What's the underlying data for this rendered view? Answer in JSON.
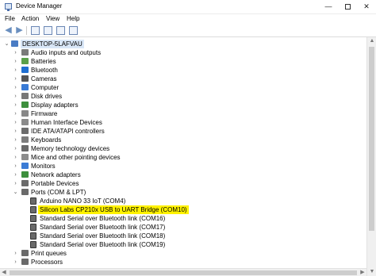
{
  "window": {
    "title": "Device Manager",
    "controls": {
      "minimize": "—",
      "close": "✕"
    }
  },
  "menu": [
    "File",
    "Action",
    "View",
    "Help"
  ],
  "toolbar": {
    "back": "◀",
    "forward": "▶"
  },
  "tree": {
    "root": "DESKTOP-5LAFVAU",
    "collapsed_glyph": "›",
    "expanded_glyph": "⌄",
    "categories": [
      {
        "label": "Audio inputs and outputs",
        "icon": "speaker-icon",
        "color": "#7a7a7a"
      },
      {
        "label": "Batteries",
        "icon": "battery-icon",
        "color": "#5aa04a"
      },
      {
        "label": "Bluetooth",
        "icon": "bluetooth-icon",
        "color": "#1f6fd1"
      },
      {
        "label": "Cameras",
        "icon": "camera-icon",
        "color": "#555555"
      },
      {
        "label": "Computer",
        "icon": "computer-icon",
        "color": "#3a7bd5"
      },
      {
        "label": "Disk drives",
        "icon": "disk-drive-icon",
        "color": "#777777"
      },
      {
        "label": "Display adapters",
        "icon": "display-adapter-icon",
        "color": "#3d8f3d"
      },
      {
        "label": "Firmware",
        "icon": "firmware-icon",
        "color": "#888888"
      },
      {
        "label": "Human Interface Devices",
        "icon": "hid-icon",
        "color": "#8a8a8a"
      },
      {
        "label": "IDE ATA/ATAPI controllers",
        "icon": "ide-controller-icon",
        "color": "#6c6c6c"
      },
      {
        "label": "Keyboards",
        "icon": "keyboard-icon",
        "color": "#7d7d7d"
      },
      {
        "label": "Memory technology devices",
        "icon": "memory-icon",
        "color": "#6a6a6a"
      },
      {
        "label": "Mice and other pointing devices",
        "icon": "mouse-icon",
        "color": "#8c8c8c"
      },
      {
        "label": "Monitors",
        "icon": "monitor-icon",
        "color": "#3a7bd5"
      },
      {
        "label": "Network adapters",
        "icon": "network-adapter-icon",
        "color": "#3d8f3d"
      },
      {
        "label": "Portable Devices",
        "icon": "portable-device-icon",
        "color": "#6a6a6a"
      },
      {
        "label": "Ports (COM & LPT)",
        "icon": "ports-icon",
        "color": "#6a6a6a",
        "expanded": true
      }
    ],
    "ports_children": [
      "Arduino NANO 33 IoT (COM4)",
      "Silicon Labs CP210x USB to UART Bridge (COM10)",
      "Standard Serial over Bluetooth link (COM16)",
      "Standard Serial over Bluetooth link (COM17)",
      "Standard Serial over Bluetooth link (COM18)",
      "Standard Serial over Bluetooth link (COM19)"
    ],
    "selected_child": 1,
    "after": [
      {
        "label": "Print queues",
        "icon": "printer-icon",
        "color": "#6a6a6a"
      },
      {
        "label": "Processors",
        "icon": "processor-icon",
        "color": "#6a6a6a"
      }
    ]
  },
  "scrollbars": {
    "up": "▲",
    "down": "▼",
    "left": "◀",
    "right": "▶"
  }
}
